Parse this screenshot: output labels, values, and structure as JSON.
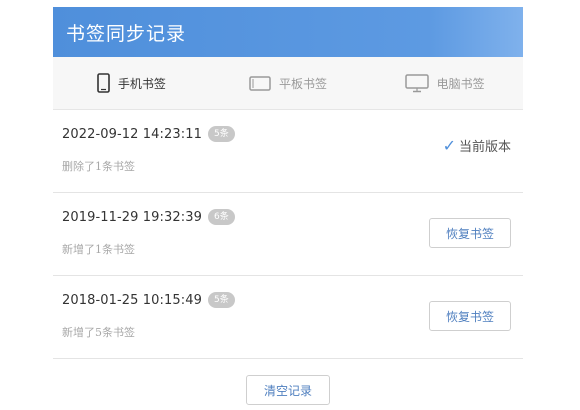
{
  "header": {
    "title": "书签同步记录"
  },
  "tabs": [
    {
      "label": "手机书签",
      "icon": "phone-icon",
      "active": true
    },
    {
      "label": "平板书签",
      "icon": "tablet-icon",
      "active": false
    },
    {
      "label": "电脑书签",
      "icon": "computer-icon",
      "active": false
    }
  ],
  "records": [
    {
      "datetime": "2022-09-12  14:23:11",
      "badge": "5条",
      "desc": "删除了1条书签",
      "status": "当前版本",
      "status_icon": "check-icon"
    },
    {
      "datetime": "2019-11-29  19:32:39",
      "badge": "6条",
      "desc": "新增了1条书签",
      "action": "恢复书签"
    },
    {
      "datetime": "2018-01-25  10:15:49",
      "badge": "5条",
      "desc": "新增了5条书签",
      "action": "恢复书签"
    }
  ],
  "footer": {
    "clear_label": "清空记录"
  },
  "colors": {
    "accent": "#4f8fdb",
    "badge": "#c8c8c8"
  }
}
